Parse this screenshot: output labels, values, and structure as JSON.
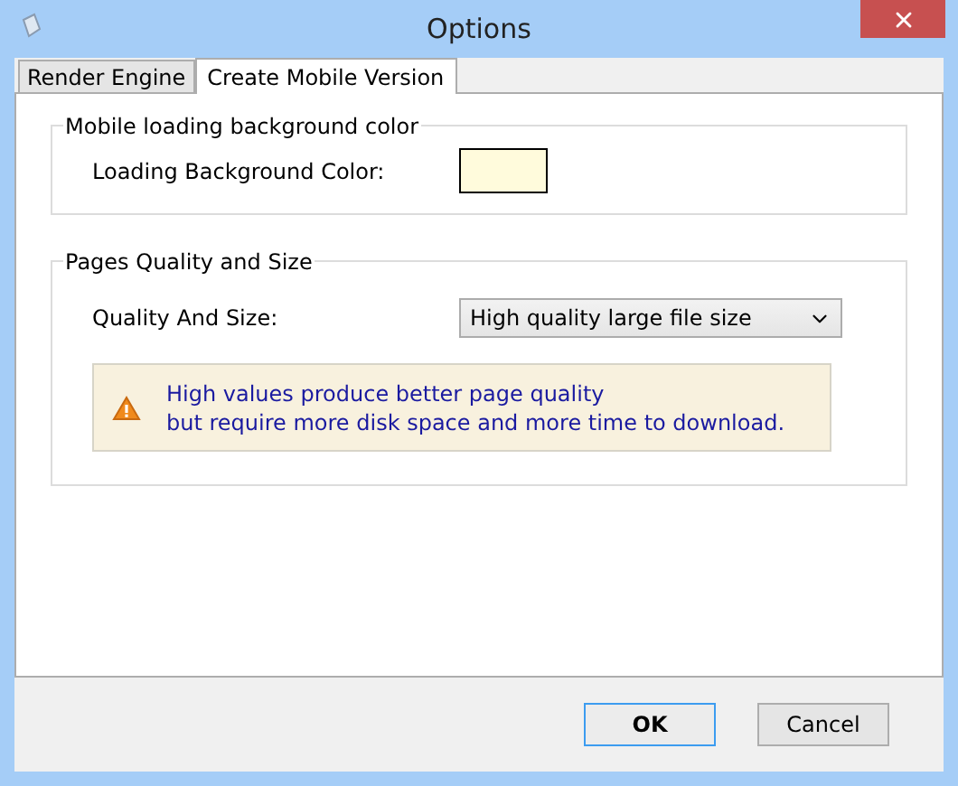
{
  "window": {
    "title": "Options"
  },
  "tabs": [
    {
      "label": "Render Engine",
      "selected": false
    },
    {
      "label": "Create Mobile Version",
      "selected": true
    }
  ],
  "background_group": {
    "title": "Mobile loading background color",
    "label": "Loading Background Color:",
    "color": "#fffbdc"
  },
  "quality_group": {
    "title": "Pages Quality and Size",
    "label": "Quality And Size:",
    "value": "High quality large file size",
    "notice": [
      "High values produce better page quality",
      "but require more disk space and more time to download."
    ]
  },
  "buttons": [
    {
      "label": "OK",
      "default": true
    },
    {
      "label": "Cancel",
      "default": false
    }
  ]
}
